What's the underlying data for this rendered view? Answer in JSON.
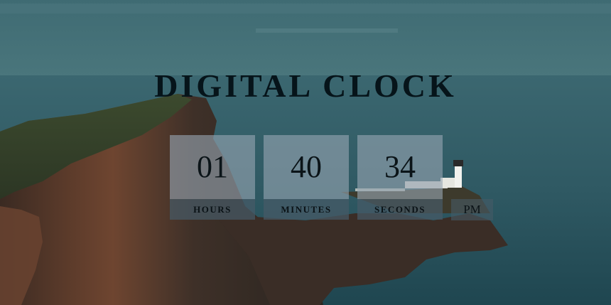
{
  "title": "DIGITAL CLOCK",
  "clock": {
    "hours": "01",
    "minutes": "40",
    "seconds": "34",
    "hours_label": "HOURS",
    "minutes_label": "MINUTES",
    "seconds_label": "SECONDS",
    "period": "PM"
  },
  "colors": {
    "value_box": "#96a5b2",
    "label_box": "#465a66",
    "text": "#0b1418"
  },
  "background": {
    "scene": "cliff-lighthouse-sea-photo"
  }
}
